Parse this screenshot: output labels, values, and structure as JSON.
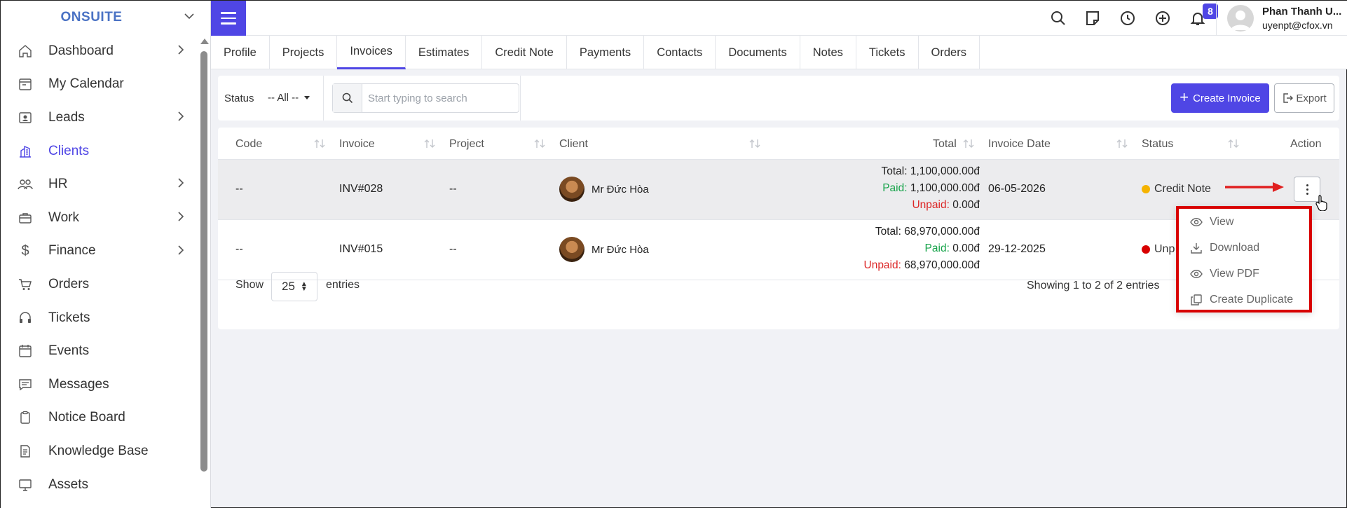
{
  "brand": {
    "name": "ONSUITE"
  },
  "sidebar": {
    "items": [
      {
        "label": "Dashboard",
        "icon": "home-icon",
        "has_arrow": true
      },
      {
        "label": "My Calendar",
        "icon": "calendar-icon",
        "has_arrow": false
      },
      {
        "label": "Leads",
        "icon": "contact-card-icon",
        "has_arrow": true
      },
      {
        "label": "Clients",
        "icon": "building-icon",
        "has_arrow": false,
        "active": true
      },
      {
        "label": "HR",
        "icon": "users-icon",
        "has_arrow": true
      },
      {
        "label": "Work",
        "icon": "briefcase-icon",
        "has_arrow": true
      },
      {
        "label": "Finance",
        "icon": "dollar-icon",
        "has_arrow": true
      },
      {
        "label": "Orders",
        "icon": "cart-icon",
        "has_arrow": false
      },
      {
        "label": "Tickets",
        "icon": "headset-icon",
        "has_arrow": false
      },
      {
        "label": "Events",
        "icon": "event-calendar-icon",
        "has_arrow": false
      },
      {
        "label": "Messages",
        "icon": "message-icon",
        "has_arrow": false
      },
      {
        "label": "Notice Board",
        "icon": "clipboard-icon",
        "has_arrow": false
      },
      {
        "label": "Knowledge Base",
        "icon": "document-icon",
        "has_arrow": false
      },
      {
        "label": "Assets",
        "icon": "monitor-icon",
        "has_arrow": false
      }
    ]
  },
  "topbar": {
    "notification_count": "8",
    "user_name": "Phan Thanh U...",
    "user_email": "uyenpt@cfox.vn"
  },
  "tabs": [
    {
      "label": "Profile"
    },
    {
      "label": "Projects"
    },
    {
      "label": "Invoices",
      "active": true
    },
    {
      "label": "Estimates"
    },
    {
      "label": "Credit Note"
    },
    {
      "label": "Payments"
    },
    {
      "label": "Contacts"
    },
    {
      "label": "Documents"
    },
    {
      "label": "Notes"
    },
    {
      "label": "Tickets"
    },
    {
      "label": "Orders"
    }
  ],
  "filters": {
    "status_label": "Status",
    "status_value": "-- All --",
    "search_placeholder": "Start typing to search",
    "create_label": "Create Invoice",
    "export_label": "Export"
  },
  "table": {
    "columns": [
      "Code",
      "Invoice",
      "Project",
      "Client",
      "Total",
      "Invoice Date",
      "Status",
      "Action"
    ],
    "rows": [
      {
        "code": "--",
        "invoice": "INV#028",
        "project": "--",
        "client": "Mr Đức Hòa",
        "total_label": "Total:",
        "total": "1,100,000.00đ",
        "paid_label": "Paid:",
        "paid": "1,100,000.00đ",
        "unpaid_label": "Unpaid:",
        "unpaid": "0.00đ",
        "date": "06-05-2026",
        "status": "Credit Note",
        "status_color": "#f5b301"
      },
      {
        "code": "--",
        "invoice": "INV#015",
        "project": "--",
        "client": "Mr Đức Hòa",
        "total_label": "Total:",
        "total": "68,970,000.00đ",
        "paid_label": "Paid:",
        "paid": "0.00đ",
        "unpaid_label": "Unpaid:",
        "unpaid": "68,970,000.00đ",
        "date": "29-12-2025",
        "status": "Unp",
        "status_color": "#d80000"
      }
    ],
    "show_label": "Show",
    "page_length": "25",
    "entries_label": "entries",
    "info": "Showing 1 to 2 of 2 entries"
  },
  "dropdown": {
    "items": [
      {
        "label": "View",
        "icon": "eye-icon"
      },
      {
        "label": "Download",
        "icon": "download-icon"
      },
      {
        "label": "View PDF",
        "icon": "eye-icon"
      },
      {
        "label": "Create Duplicate",
        "icon": "copy-icon"
      }
    ]
  },
  "colors": {
    "accent": "#4f46e5",
    "annotation": "#d80000",
    "paid": "#16a34a",
    "unpaid": "#dc2626"
  }
}
